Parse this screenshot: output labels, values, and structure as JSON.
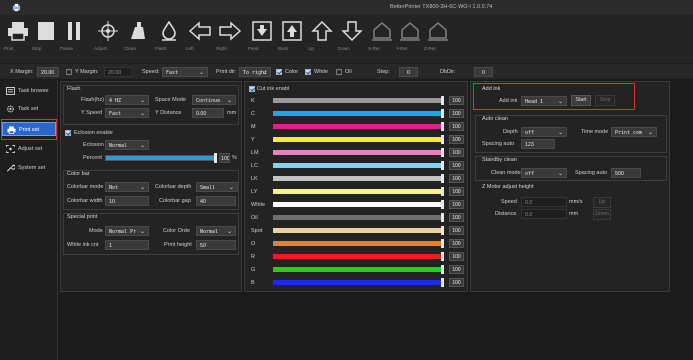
{
  "window": {
    "title": "BetterPrinter TX800-3H-6C-WO-I 1.0.0.74",
    "accent_color": "#2b67c8",
    "highlight_color": "#e03030"
  },
  "toolbar": {
    "buttons": [
      {
        "label": "Print",
        "icon": "printer-icon"
      },
      {
        "label": "Stop",
        "icon": "stop-icon"
      },
      {
        "label": "Pause",
        "icon": "pause-icon"
      },
      {
        "label": "Adjust",
        "icon": "crosshair-icon"
      },
      {
        "label": "Clean",
        "icon": "clean-icon"
      },
      {
        "label": "Flash",
        "icon": "ink-drop-icon"
      },
      {
        "label": "Left",
        "icon": "arrow-left-icon"
      },
      {
        "label": "Right",
        "icon": "arrow-right-icon"
      },
      {
        "label": "Feed",
        "icon": "feed-icon"
      },
      {
        "label": "Back",
        "icon": "back-icon"
      },
      {
        "label": "Up",
        "icon": "arrow-up-icon"
      },
      {
        "label": "Down",
        "icon": "arrow-down-icon"
      },
      {
        "label": "X-Ret",
        "icon": "home-x-icon"
      },
      {
        "label": "Y-Ret",
        "icon": "home-y-icon"
      },
      {
        "label": "Z-Ret",
        "icon": "home-z-icon"
      }
    ]
  },
  "params": {
    "x_margin_label": "X Margin:",
    "x_margin_value": "20.00",
    "y_margin_label": "Y Margin:",
    "y_margin_value": "20.00",
    "speed_label": "Speed:",
    "speed_value": "Fast",
    "print_dir_label": "Print dir:",
    "print_dir_value": "To right",
    "color_label": "Color",
    "white_label": "White",
    "oil_label": "Oil",
    "step_label": "Step:",
    "step_value": "0",
    "dbdir_label": "DbDir:",
    "dbdir_value": "0"
  },
  "sidebar": {
    "items": [
      {
        "label": "Task browse",
        "icon": "browse-icon"
      },
      {
        "label": "Task set",
        "icon": "gear-icon"
      },
      {
        "label": "Print set",
        "icon": "printer-icon"
      },
      {
        "label": "Adjust set",
        "icon": "adjust-icon"
      },
      {
        "label": "System set",
        "icon": "wrench-icon"
      }
    ]
  },
  "flash": {
    "title": "Flash",
    "flash_hz_label": "Flash(hz)",
    "flash_hz_value": "4 HZ",
    "space_mode_label": "Space Mode",
    "space_mode_value": "Continue",
    "y_speed_label": "Y Speed",
    "y_speed_value": "Fast",
    "y_distance_label": "Y Distance",
    "y_distance_value": "0.00",
    "y_distance_unit": "mm"
  },
  "eclosion": {
    "enable_label": "Eclosion enable",
    "eclosion_label": "Eclosion",
    "eclosion_value": "Normal",
    "percent_label": "Percent",
    "percent_value": "100",
    "percent_unit": "%",
    "percent_fraction": 1.0
  },
  "color_bar": {
    "title": "Color bar",
    "mode_label": "Colorbar mode",
    "mode_value": "Not",
    "depth_label": "Colorbar depth",
    "depth_value": "Small",
    "width_label": "Colorbar width",
    "width_value": "10",
    "gap_label": "Colorbar gap",
    "gap_value": "40"
  },
  "special_print": {
    "title": "Special print",
    "mode_label": "Mode",
    "mode_value": "Normal Pr",
    "order_label": "Color Orde",
    "order_value": "Normal",
    "white_cnt_label": "White ink cnt",
    "white_cnt_value": "1",
    "height_label": "Print height",
    "height_value": "50"
  },
  "inks": {
    "cut_label": "Cut ink enabl",
    "rows": [
      {
        "name": "K",
        "color": "#9a9a9a",
        "value": "100"
      },
      {
        "name": "C",
        "color": "#1aa7e8",
        "value": "100"
      },
      {
        "name": "M",
        "color": "#e0208a",
        "value": "100"
      },
      {
        "name": "Y",
        "color": "#f2ee2e",
        "value": "100"
      },
      {
        "name": "LM",
        "color": "#f07cc4",
        "value": "100"
      },
      {
        "name": "LC",
        "color": "#84d2f2",
        "value": "100"
      },
      {
        "name": "LK",
        "color": "#c4c4c4",
        "value": "100"
      },
      {
        "name": "LY",
        "color": "#f7f291",
        "value": "100"
      },
      {
        "name": "White",
        "color": "#ffffff",
        "value": "100"
      },
      {
        "name": "Oil",
        "color": "#6e6e6e",
        "value": "100"
      },
      {
        "name": "Spot",
        "color": "#ead29a",
        "value": "100"
      },
      {
        "name": "O",
        "color": "#f07d20",
        "value": "100"
      },
      {
        "name": "R",
        "color": "#ec1c1c",
        "value": "100"
      },
      {
        "name": "G",
        "color": "#1cd41c",
        "value": "100"
      },
      {
        "name": "B",
        "color": "#1c2cf2",
        "value": "100"
      }
    ]
  },
  "add_ink": {
    "title": "Add ink",
    "label": "Add ink",
    "value": "Head 1",
    "start": "Start",
    "stop": "Stop"
  },
  "auto_clean": {
    "title": "Auto clean",
    "depth_label": "Depth",
    "depth_value": "off",
    "time_mode_label": "Time mode",
    "time_mode_value": "Print com",
    "spacing_label": "Spacing auto",
    "spacing_value": "123"
  },
  "standby": {
    "title": "Standby clean",
    "mode_label": "Clean mode",
    "mode_value": "off",
    "spacing_label": "Spacing auto",
    "spacing_value": "500"
  },
  "zmotor": {
    "title": "Z Motor adjust height",
    "speed_label": "Speed",
    "speed_value": "0.0",
    "speed_unit": "mm/s",
    "distance_label": "Distance",
    "distance_value": "0.0",
    "distance_unit": "mm",
    "up": "Up",
    "down": "Down"
  }
}
